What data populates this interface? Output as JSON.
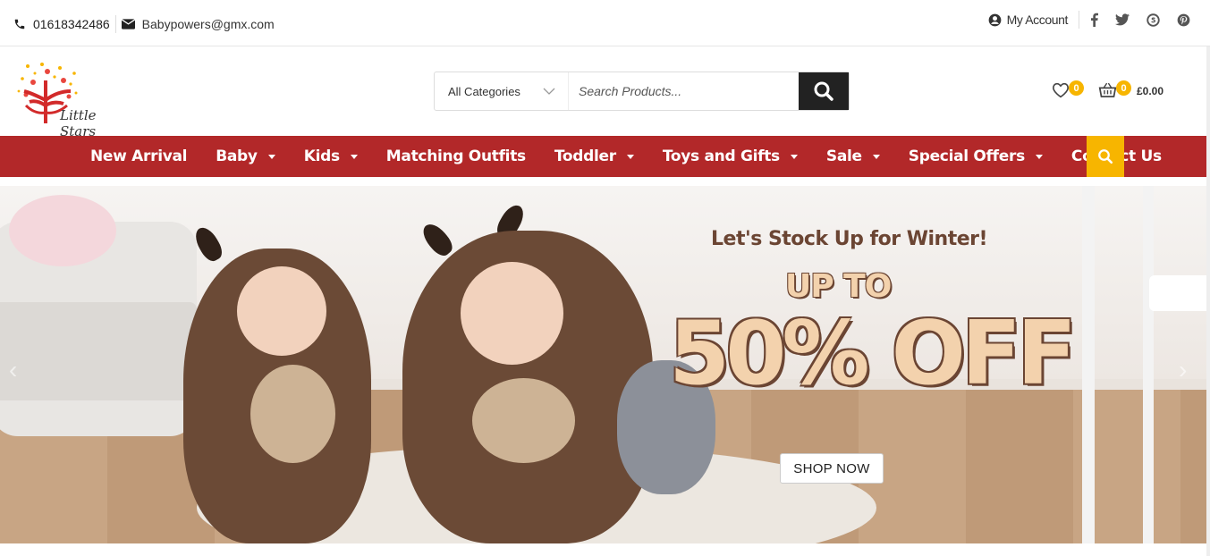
{
  "topbar": {
    "phone": "01618342486",
    "email": "Babypowers@gmx.com",
    "account_label": "My Account",
    "social": [
      "facebook-icon",
      "twitter-icon",
      "skype-icon",
      "pinterest-icon"
    ]
  },
  "header": {
    "logo_text": "Little Stars",
    "category_selected": "All Categories",
    "search_placeholder": "Search Products...",
    "wishlist_count": "0",
    "cart_count": "0",
    "cart_total": "£0.00"
  },
  "nav": {
    "items": [
      {
        "label": "New Arrival",
        "dropdown": false
      },
      {
        "label": "Baby",
        "dropdown": true
      },
      {
        "label": "Kids",
        "dropdown": true
      },
      {
        "label": "Matching Outfits",
        "dropdown": false
      },
      {
        "label": "Toddler",
        "dropdown": true
      },
      {
        "label": "Toys and Gifts",
        "dropdown": true
      },
      {
        "label": "Sale",
        "dropdown": true
      },
      {
        "label": "Special Offers",
        "dropdown": true
      },
      {
        "label": "Contact Us",
        "dropdown": false
      }
    ]
  },
  "banner": {
    "line1": "Let's Stock Up for Winter!",
    "line2": "UP TO",
    "line3": "50% OFF",
    "cta": "SHOP NOW"
  },
  "colors": {
    "nav_bg": "#b22829",
    "accent": "#f7b500",
    "dark": "#222222"
  }
}
